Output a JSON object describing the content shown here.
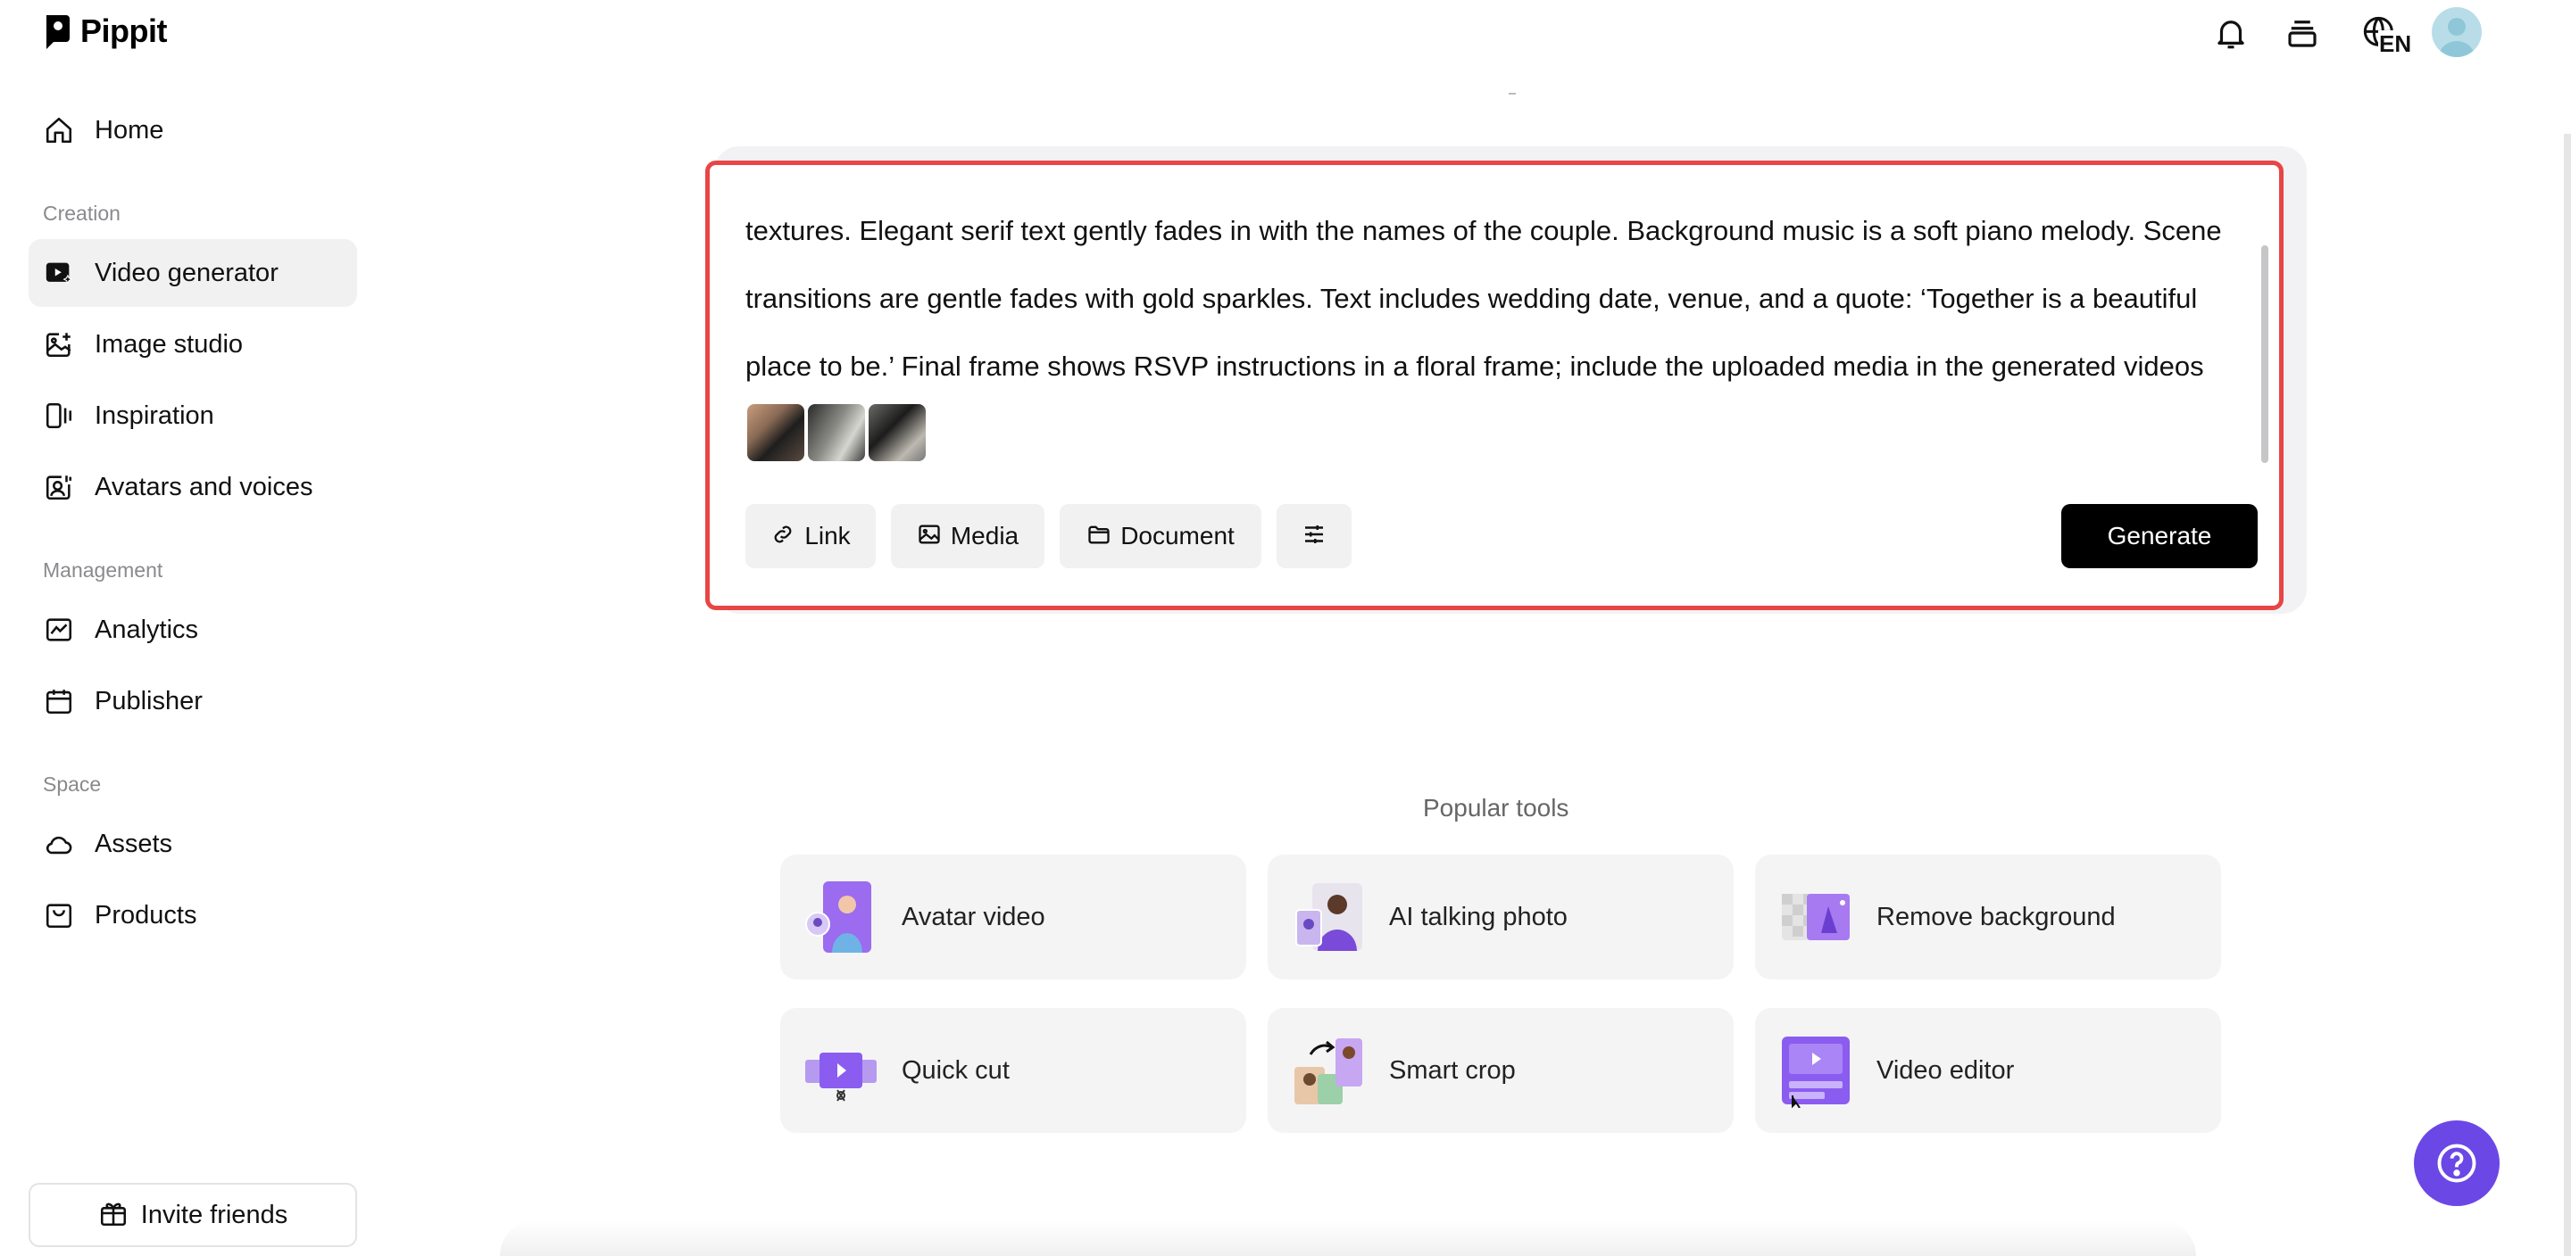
{
  "app": {
    "logo_text": "Pippit"
  },
  "sidebar": {
    "home": "Home",
    "sections": {
      "creation": "Creation",
      "management": "Management",
      "space": "Space"
    },
    "items": {
      "video_generator": "Video generator",
      "image_studio": "Image studio",
      "inspiration": "Inspiration",
      "avatars_voices": "Avatars and voices",
      "analytics": "Analytics",
      "publisher": "Publisher",
      "assets": "Assets",
      "products": "Products"
    },
    "invite": "Invite friends"
  },
  "topbar": {
    "language": "EN"
  },
  "prompt": {
    "text": "textures. Elegant serif text gently fades in with the names of the couple. Background music is a soft piano melody. Scene transitions are gentle fades with gold sparkles. Text includes wedding date, venue, and a quote: ‘Together is a beautiful place to be.’ Final frame shows RSVP instructions in a floral frame; include the uploaded media in the generated videos",
    "chips": {
      "link": "Link",
      "media": "Media",
      "document": "Document"
    },
    "generate": "Generate"
  },
  "popular": {
    "label": "Popular tools",
    "tools": [
      {
        "label": "Avatar video"
      },
      {
        "label": "AI talking photo"
      },
      {
        "label": "Remove background"
      },
      {
        "label": "Quick cut"
      },
      {
        "label": "Smart crop"
      },
      {
        "label": "Video editor"
      }
    ]
  },
  "colors": {
    "accent": "#6b47e6",
    "highlight": "#e84545",
    "button": "#000000"
  }
}
